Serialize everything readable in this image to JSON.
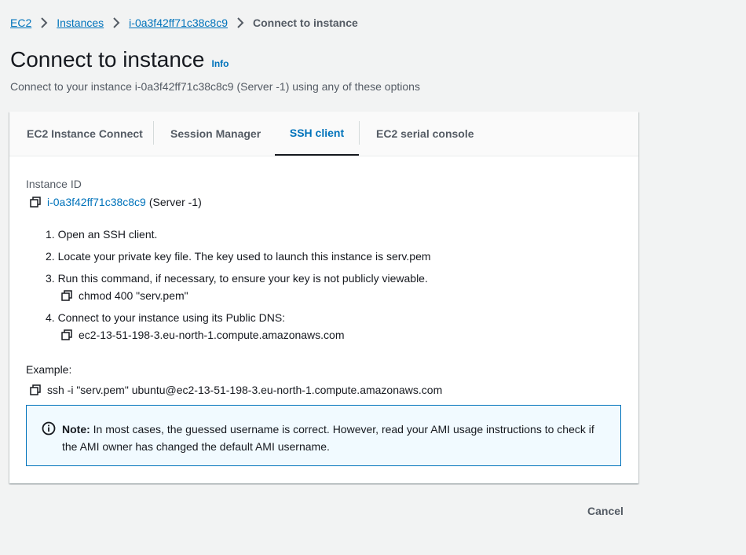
{
  "breadcrumb": {
    "items": [
      "EC2",
      "Instances",
      "i-0a3f42ff71c38c8c9"
    ],
    "current": "Connect to instance"
  },
  "header": {
    "title": "Connect to instance",
    "info": "Info",
    "subtitle": "Connect to your instance i-0a3f42ff71c38c8c9 (Server -1) using any of these options"
  },
  "tabs": [
    {
      "label": "EC2 Instance Connect"
    },
    {
      "label": "Session Manager"
    },
    {
      "label": "SSH client",
      "active": true
    },
    {
      "label": "EC2 serial console"
    }
  ],
  "ssh": {
    "instance_id_label": "Instance ID",
    "instance_id": "i-0a3f42ff71c38c8c9",
    "instance_name": "(Server -1)",
    "steps": [
      "1. Open an SSH client.",
      "2. Locate your private key file. The key used to launch this instance is serv.pem",
      "3. Run this command, if necessary, to ensure your key is not publicly viewable.",
      "4. Connect to your instance using its Public DNS:"
    ],
    "chmod_cmd": "chmod 400 \"serv.pem\"",
    "public_dns": "ec2-13-51-198-3.eu-north-1.compute.amazonaws.com",
    "example_label": "Example:",
    "example_cmd": "ssh -i \"serv.pem\" ubuntu@ec2-13-51-198-3.eu-north-1.compute.amazonaws.com"
  },
  "note": {
    "bold": "Note:",
    "text": " In most cases, the guessed username is correct. However, read your AMI usage instructions to check if the AMI owner has changed the default AMI username."
  },
  "footer": {
    "cancel": "Cancel"
  },
  "colors": {
    "link": "#0073bb",
    "background": "#f2f3f3",
    "note_bg": "#f1faff"
  },
  "icons": [
    "chevron-right-icon",
    "copy-icon",
    "info-circle-icon"
  ]
}
